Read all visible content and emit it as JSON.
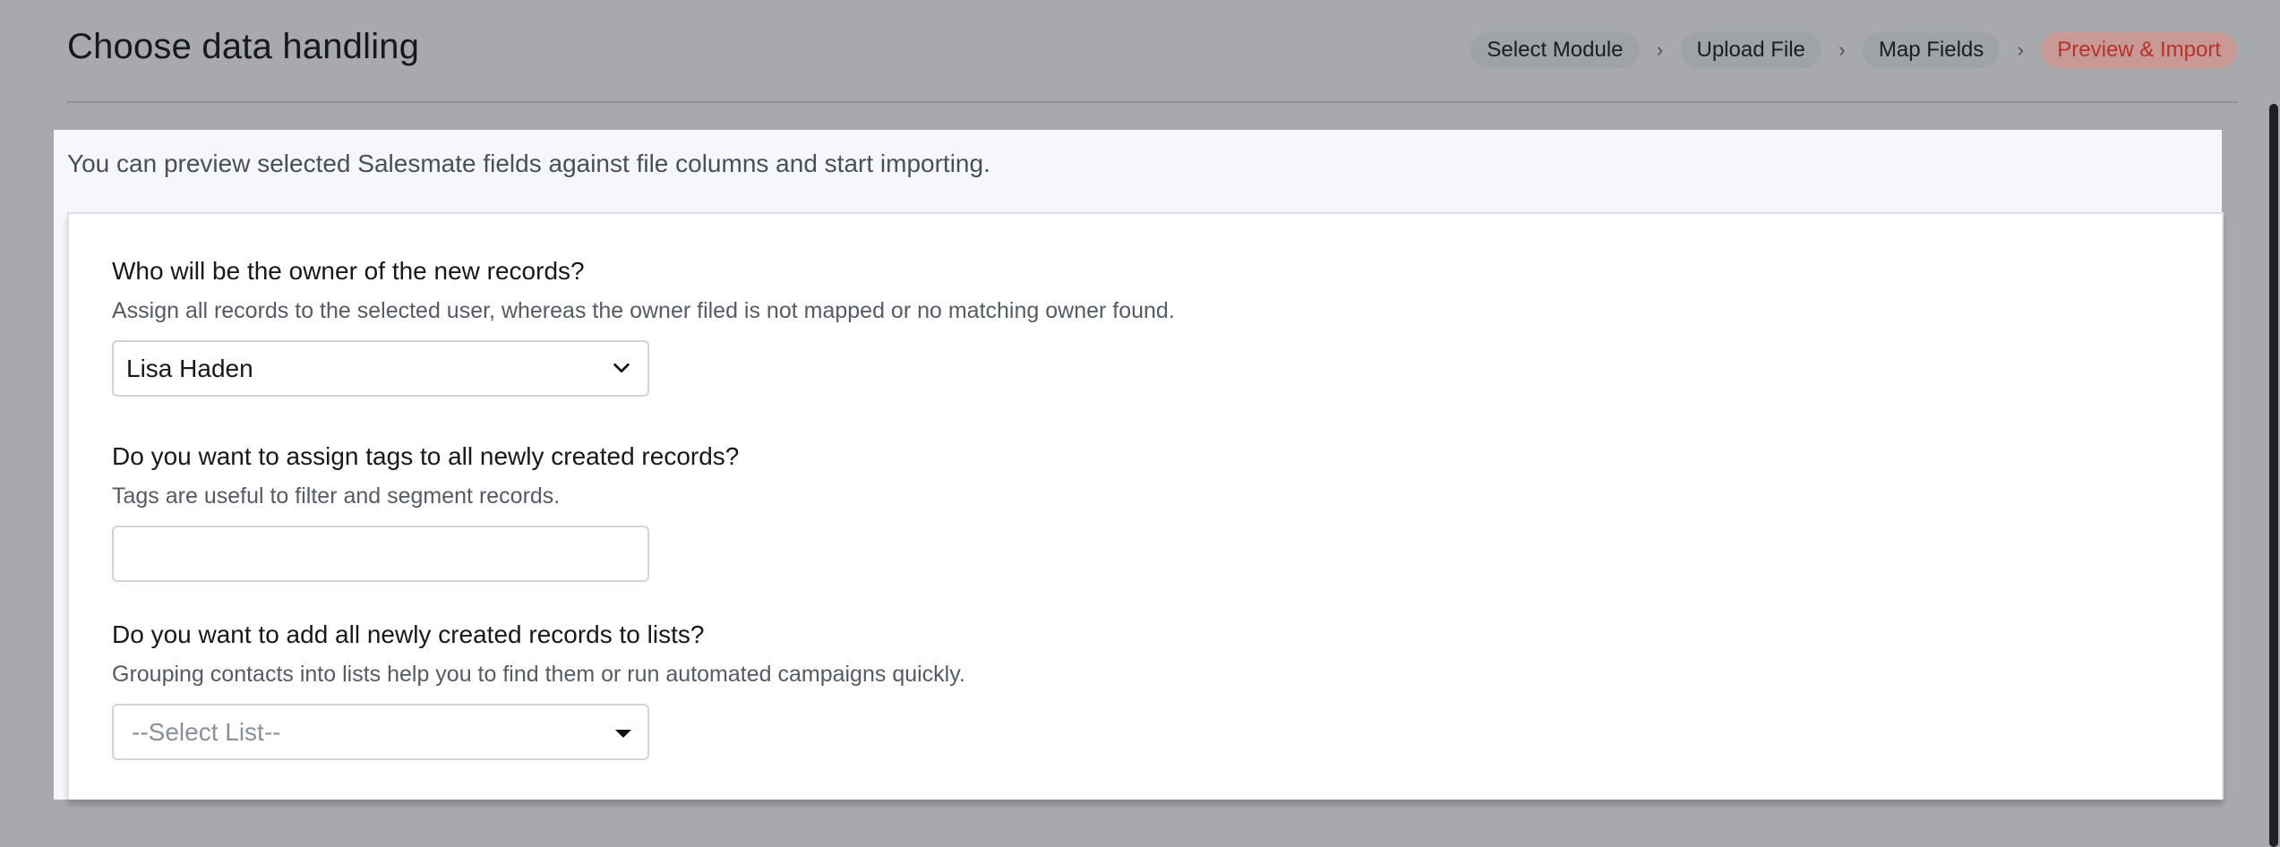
{
  "header": {
    "title": "Choose data handling",
    "steps": [
      {
        "label": "Select Module",
        "active": false
      },
      {
        "label": "Upload File",
        "active": false
      },
      {
        "label": "Map Fields",
        "active": false
      },
      {
        "label": "Preview & Import",
        "active": true
      }
    ]
  },
  "main": {
    "intro": "You can preview selected Salesmate fields against file columns and start importing.",
    "owner": {
      "question": "Who will be the owner of the new records?",
      "help": "Assign all records to the selected user, whereas the owner filed is not mapped or no matching owner found.",
      "selected": "Lisa Haden",
      "icon": "chevron-down-icon"
    },
    "tags": {
      "question": "Do you want to assign tags to all newly created records?",
      "help": "Tags are useful to filter and segment records.",
      "value": ""
    },
    "lists": {
      "question": "Do you want to add all newly created records to lists?",
      "help": "Grouping contacts into lists help you to find them or run automated campaigns quickly.",
      "placeholder": "--Select List--",
      "icon": "caret-down-icon"
    }
  },
  "colors": {
    "overlay": "#a7a9ac",
    "active_step_text": "#b8322a",
    "active_step_bg": "#c99a95"
  }
}
